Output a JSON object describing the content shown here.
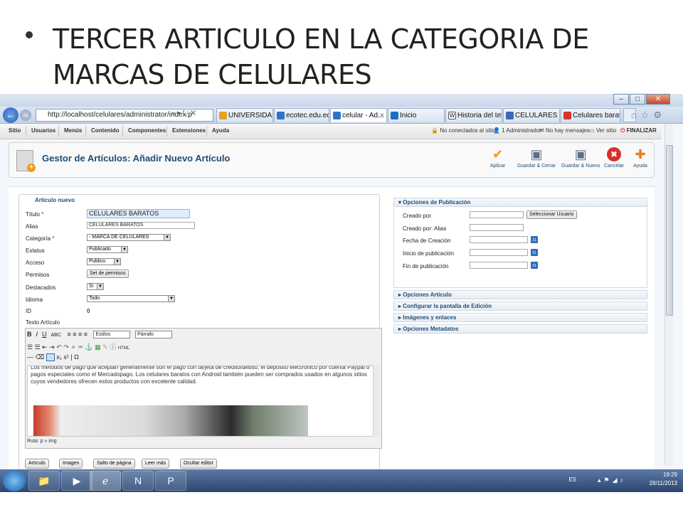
{
  "slide": {
    "bullet_text": "TERCER ARTICULO EN LA CATEGORIA DE MARCAS DE CELULARES"
  },
  "browser": {
    "address": "http://localhost/celulares/administrator/index.p",
    "tabs": [
      {
        "label": "UNIVERSIDAD ...",
        "color": "#e6a321"
      },
      {
        "label": "ecotec.edu.ec",
        "color": "#2f73c9"
      },
      {
        "label": "celular - Ad...",
        "color": "#2f73c9",
        "active": true
      },
      {
        "label": "Inicio",
        "color": "#1d6fbf"
      },
      {
        "label": "Historia del tel...",
        "color": "#333333"
      },
      {
        "label": "CELULARES BA...",
        "color": "#3b68b8"
      },
      {
        "label": "Celulares barat...",
        "color": "#d6332b"
      }
    ],
    "window_buttons": [
      "–",
      "□",
      "✕"
    ]
  },
  "joomla_menu": {
    "items": [
      "Sitio",
      "Usuarios",
      "Menús",
      "Contenido",
      "Componentes",
      "Extensiones",
      "Ayuda"
    ],
    "status": {
      "visitors": "No conectados al sitio",
      "admins": "1 Administrador",
      "messages": "No hay mensajes",
      "view_site": "Ver sitio",
      "logout": "FINALIZAR"
    }
  },
  "toolbar": {
    "title": "Gestor de Artículos: Añadir Nuevo Artículo",
    "buttons": [
      {
        "label": "Aplicar",
        "icon": "check-icon",
        "glyph": "✔",
        "color": "#f39c12"
      },
      {
        "label": "Guardar & Cerrar",
        "icon": "save-close-icon",
        "glyph": "▣",
        "color": "#5b6f86"
      },
      {
        "label": "Guardar & Nuevo",
        "icon": "save-new-icon",
        "glyph": "▣",
        "color": "#5b6f86"
      },
      {
        "label": "Cancelar",
        "icon": "cancel-icon",
        "glyph": "✖",
        "color": "#d6332b"
      },
      {
        "label": "Ayuda",
        "icon": "help-icon",
        "glyph": "✚",
        "color": "#e67e22"
      }
    ]
  },
  "form": {
    "legend": "Artículo nuevo",
    "title_label": "Título",
    "title_value": "CELULARES BARATOS",
    "alias_label": "Alias",
    "alias_value": "CELULARES BARATOS",
    "category_label": "Categoría",
    "category_value": "- MARCA DE CELULARES",
    "status_label": "Estatus",
    "status_value": "Publicado",
    "access_label": "Acceso",
    "access_value": "Publico",
    "permissions_label": "Permisos",
    "permissions_button": "Set de permisos",
    "featured_label": "Destacados",
    "featured_value": "Si",
    "language_label": "Idioma",
    "language_value": "Todo",
    "id_label": "ID",
    "id_value": "0",
    "text_label": "Texto Artículo"
  },
  "editor": {
    "styles_select": "Estilos",
    "format_select": "Párrafo",
    "html_label": "HTML",
    "body_line1": "Los métodos de pago que aceptan generalmente son el pago con tarjeta de crédito/débito, el depósito electrónico por cuenta Paypal o",
    "body_line2": "pagos especiales como el Mercadopago. Los celulares baratos con Android también pueden ser comprados usados en algunos sitios",
    "body_line3": "cuyos vendedores ofrecen estos productos con excelente calidad.",
    "path": "Ruta: p » img",
    "bottom_buttons": [
      "Artículo",
      "Imagen",
      "Salto de página",
      "Leer más",
      "Ocultar editor"
    ]
  },
  "publishing": {
    "header": "Opciones de Publicación",
    "created_by": "Creado por",
    "select_user": "Seleccionar Usuario",
    "created_by_alias": "Creado por: Alias",
    "created_date": "Fecha de Creación",
    "publish_up": "Inicio de publicación",
    "publish_down": "Fin de publicación",
    "calendar_label": "31"
  },
  "accordions": [
    "Opciones Artículo",
    "Configurar la pantalla de Edición",
    "Imágenes y enlaces",
    "Opciones Metadatos"
  ],
  "taskbar": {
    "lang": "ES",
    "time": "19:29",
    "date": "28/11/2013"
  }
}
